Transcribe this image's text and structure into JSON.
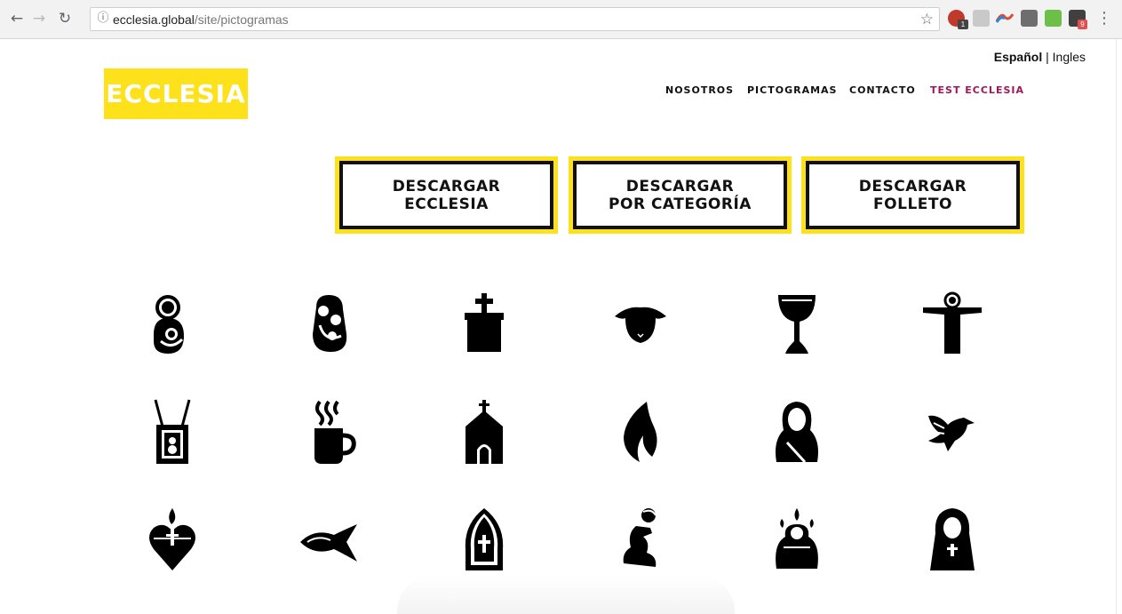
{
  "browser": {
    "url_host": "ecclesia.global",
    "url_path": "/site/pictogramas",
    "back_icon": "arrow-left-icon",
    "forward_icon": "arrow-right-icon",
    "reload_icon": "reload-icon",
    "info_icon": "info-icon",
    "bookmark_icon": "star-icon",
    "extension_badges": {
      "first": "1",
      "last": "9"
    }
  },
  "language": {
    "current": "Español",
    "separator": " | ",
    "other": "Ingles"
  },
  "logo": {
    "text": "ECCLESIA",
    "color": "#fde11a"
  },
  "nav": {
    "items": [
      {
        "label": "NOSOTROS"
      },
      {
        "label": "PICTOGRAMAS"
      },
      {
        "label": "CONTACTO"
      },
      {
        "label": "TEST ECCLESIA",
        "active": true
      }
    ],
    "active_color": "#a0165a"
  },
  "downloads": [
    {
      "label": "DESCARGAR\nECCLESIA"
    },
    {
      "label": "DESCARGAR\nPOR CATEGORÍA"
    },
    {
      "label": "DESCARGAR\nFOLLETO"
    }
  ],
  "pictograms": [
    "mary-and-child-icon",
    "holy-family-icon",
    "grave-cross-icon",
    "lamb-icon",
    "chalice-icon",
    "christ-redeemer-icon",
    "scapular-icon",
    "hot-drink-icon",
    "chapel-icon",
    "flame-icon",
    "veiled-woman-icon",
    "dove-icon",
    "sacred-heart-icon",
    "ichthys-fish-icon",
    "mitre-icon",
    "kneeling-person-icon",
    "pentecost-icon",
    "nun-icon"
  ]
}
